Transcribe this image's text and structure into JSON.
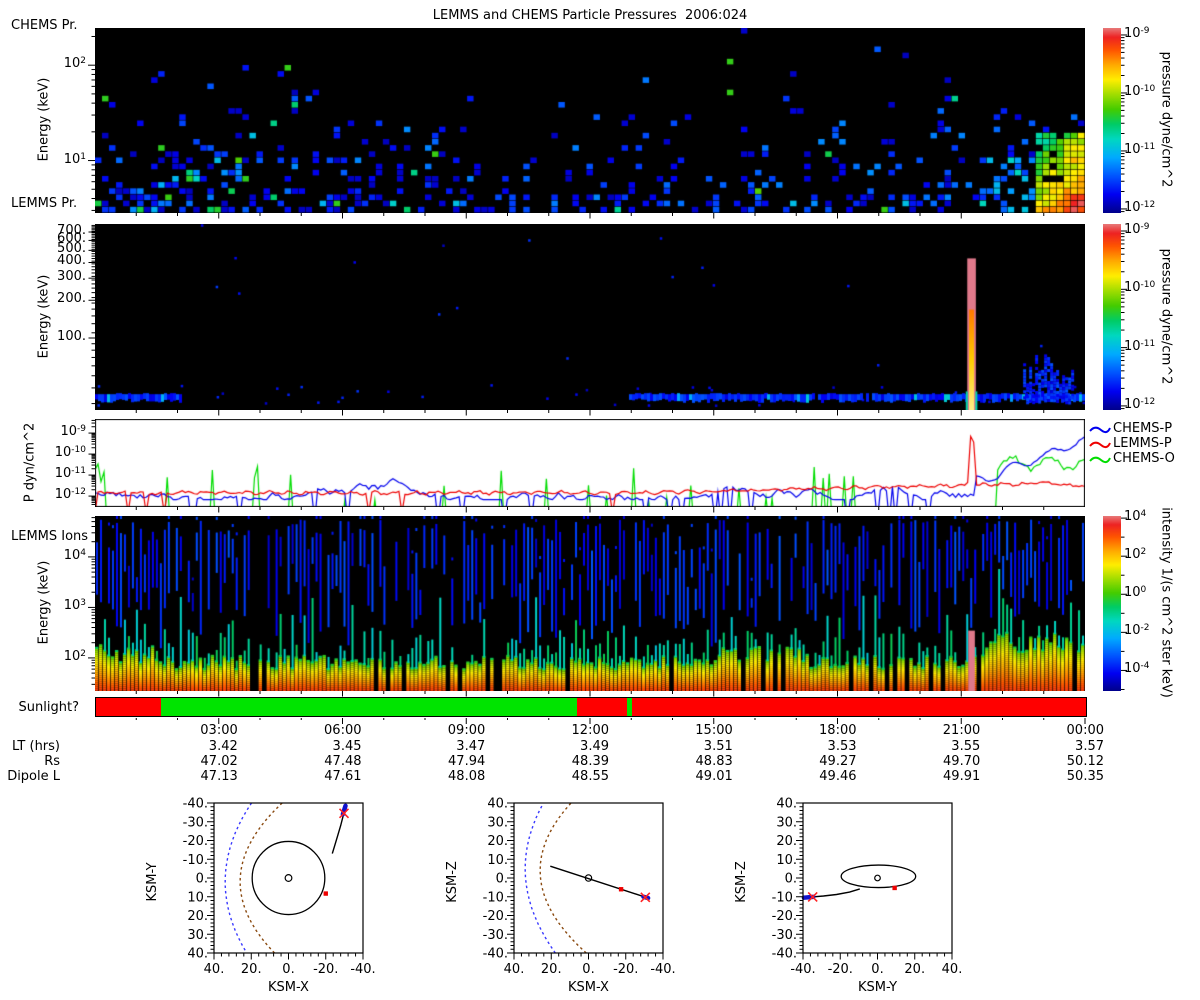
{
  "title": "LEMMS and CHEMS Particle Pressures  2006:024",
  "panel_labels": {
    "chems_pr": "CHEMS Pr.",
    "lemms_pr": "LEMMS Pr.",
    "lemms_ions": "LEMMS Ions",
    "sunlight": "Sunlight?"
  },
  "axis_labels": {
    "energy": "Energy (keV)",
    "pressure_panel": "P dyn/cm^2",
    "pressure_cb": "pressure dyne/cm^2",
    "intensity_cb": "intensity 1/(s cm^2 ster keV)"
  },
  "legend": [
    {
      "label": "CHEMS-P",
      "color": "#0000ee"
    },
    {
      "label": "LEMMS-P",
      "color": "#ee0000"
    },
    {
      "label": "CHEMS-O",
      "color": "#00dd00"
    }
  ],
  "colors": {
    "sunlight_red": "#ff0000",
    "sunlight_green": "#00e400",
    "spike_salmon": "#e0798b",
    "panel_bg": "#000000",
    "colormap": [
      [
        0,
        "#00008a"
      ],
      [
        0.1,
        "#0000f2"
      ],
      [
        0.2,
        "#0055ff"
      ],
      [
        0.3,
        "#00aaff"
      ],
      [
        0.4,
        "#00d8c0"
      ],
      [
        0.48,
        "#00cc66"
      ],
      [
        0.56,
        "#44cc00"
      ],
      [
        0.64,
        "#a0dd00"
      ],
      [
        0.72,
        "#ffee00"
      ],
      [
        0.8,
        "#ffaa00"
      ],
      [
        0.88,
        "#ff5500"
      ],
      [
        0.95,
        "#ee2222"
      ],
      [
        1,
        "#e87a7a"
      ]
    ]
  },
  "time_axis": {
    "tick_hours": [
      3,
      6,
      9,
      12,
      15,
      18,
      21,
      24
    ],
    "tick_labels": [
      "03:00",
      "06:00",
      "09:00",
      "12:00",
      "15:00",
      "18:00",
      "21:00",
      "00:00"
    ],
    "rows": [
      {
        "label": "LT (hrs)",
        "values": [
          "3.42",
          "3.45",
          "3.47",
          "3.49",
          "3.51",
          "3.53",
          "3.55",
          "3.57"
        ]
      },
      {
        "label": "Rs",
        "values": [
          "47.02",
          "47.48",
          "47.94",
          "48.39",
          "48.83",
          "49.27",
          "49.70",
          "50.12"
        ]
      },
      {
        "label": "Dipole L",
        "values": [
          "47.13",
          "47.61",
          "48.08",
          "48.55",
          "49.01",
          "49.46",
          "49.91",
          "50.35"
        ]
      }
    ]
  },
  "sunlight_segments": [
    {
      "from_h": 0,
      "to_h": 1.58,
      "color": "red"
    },
    {
      "from_h": 1.58,
      "to_h": 11.66,
      "color": "green"
    },
    {
      "from_h": 11.66,
      "to_h": 12.87,
      "color": "red"
    },
    {
      "from_h": 12.87,
      "to_h": 13.0,
      "color": "green"
    },
    {
      "from_h": 13.0,
      "to_h": 24,
      "color": "red"
    }
  ],
  "chart_data": [
    {
      "id": "chems_pressure",
      "type": "heatmap",
      "panel_label": "CHEMS Pr.",
      "ylabel": "Energy (keV)",
      "yticks": [
        "10^1",
        "10^2"
      ],
      "ylim_log_kev": [
        2.39,
        0.45
      ],
      "xlim_hours": [
        0,
        24
      ],
      "grid": false,
      "colorbar": {
        "label": "pressure dyne/cm^2",
        "ticks": [
          "10^-9",
          "10^-10",
          "10^-11",
          "10^-12"
        ],
        "range_log": [
          -8.88,
          -12.07
        ]
      },
      "description": "sparse blue pixels, denser at low energy and in first third; hot yellow-orange-red blob bottom right near 23:00-24:00",
      "gen": {
        "seed": 11,
        "cols": 141,
        "rows": 30,
        "base": 0.015,
        "bottom_gain": 0.3,
        "bottom_pow": 2.8,
        "left_frac": 0.345,
        "left_mult": 1.25,
        "mid_mult": 0.7,
        "right_mult": 0.95,
        "quiet_top_frac": 0.2,
        "quiet_mult": 0.3,
        "green_prob": 0.1,
        "blue_v": [
          0.05,
          0.27
        ],
        "green_v": [
          0.3,
          0.58
        ],
        "hot": {
          "col_frac": 0.953,
          "row_frac": 0.58,
          "density": 0.92,
          "v_base": 0.32,
          "v_span": 0.55
        },
        "near": {
          "col_frac": 0.9,
          "row_frac": 0.7,
          "density": 0.45
        }
      }
    },
    {
      "id": "lemms_pressure",
      "type": "heatmap",
      "panel_label": "LEMMS Pr.",
      "ylabel": "Energy (keV)",
      "yticks": [
        "100.",
        "200.",
        "300.",
        "400.",
        "500.",
        "600.",
        "700."
      ],
      "ylim_log_kev": [
        2.909,
        1.426
      ],
      "xlim_hours": [
        0,
        24
      ],
      "grid": false,
      "colorbar": {
        "label": "pressure dyne/cm^2",
        "ticks": [
          "10^-9",
          "10^-10",
          "10^-11",
          "10^-12"
        ],
        "range_log": [
          -8.88,
          -12.07
        ]
      },
      "description": "black panel with thin blue ~30 keV band 00:00-02:00 and 12:55-24:00, blue blob 22:30-23:45, intense salmon/orange injection spike at ~21:15",
      "gen": {
        "seed": 22,
        "band_segments_hours": [
          [
            0,
            2.06
          ],
          [
            12.9,
            24
          ]
        ],
        "band_frac": [
          0.915,
          0.962
        ],
        "band_v": [
          0.08,
          0.2
        ],
        "cyan_prob": 0.08,
        "dot_count": 60,
        "blob": {
          "hours": [
            22.5,
            23.72
          ],
          "frac": [
            0.7,
            0.955
          ],
          "col_prob": 0.85,
          "v": [
            0.08,
            0.2
          ]
        },
        "spike": {
          "hours": [
            21.17,
            21.33
          ],
          "bar_top_frac": 0.185,
          "core_top_frac": 0.46,
          "bar_color": "#e0798b",
          "core_stops": [
            "#ff7700",
            "#ffcc00",
            "#ffee88"
          ]
        }
      }
    },
    {
      "id": "particle_pressures",
      "type": "line",
      "ylabel": "P dyn/cm^2",
      "yticks": [
        "10^-9",
        "10^-10",
        "10^-11",
        "10^-12"
      ],
      "ylim_log": [
        -8.33,
        -12.52
      ],
      "xlim_hours": [
        0,
        24
      ],
      "legend_position": "right",
      "series": [
        {
          "name": "CHEMS-P",
          "color": "#0000ee",
          "gen": {
            "seed": 51,
            "base": -11.72,
            "walk": 0.35,
            "clamp": [
              -0.45,
              0.55
            ],
            "dip_prob": 0.055,
            "dip_v": -13.2,
            "rise_start_h": 21.35,
            "rise_end_level": -9.3
          }
        },
        {
          "name": "LEMMS-P",
          "color": "#ee0000",
          "gen": {
            "seed": 52,
            "base": -11.84,
            "noise": 0.06,
            "rise_start_h": 13.5,
            "rise_rate": 0.048,
            "rise_cap": 0.45,
            "end_dip_h": 23.1,
            "end_dip_rate": 0.15,
            "spike_h": 21.26,
            "spike_halfwidth_h": 0.11,
            "spike_peak": -8.2
          }
        },
        {
          "name": "CHEMS-O",
          "color": "#00dd00",
          "gen": {
            "seed": 53,
            "floor": -13.4,
            "spike_prob": 0.085,
            "spike_v": [
              -12.35,
              -10.4
            ],
            "cont_start_h": 21.85,
            "cont_base": -10.45,
            "cont_wiggle": 0.3
          }
        }
      ]
    },
    {
      "id": "lemms_ions",
      "type": "heatmap",
      "panel_label": "LEMMS Ions",
      "ylabel": "Energy (keV)",
      "yticks": [
        "10^2",
        "10^3",
        "10^4"
      ],
      "ylim_log_kev": [
        4.81,
        1.345
      ],
      "xlim_hours": [
        0,
        24
      ],
      "grid": false,
      "colorbar": {
        "label": "intensity 1/(s cm^2 ster keV)",
        "ticks": [
          "10^4",
          "10^2",
          "10^0",
          "10^-2",
          "10^-4"
        ],
        "range_log": [
          4.11,
          -5.08
        ]
      },
      "description": "dense vertical striped spectrogram: orange-red band at low energy, teal-green stems mid, sparse blue stems high energy; salmon bar at ~21:15; stronger orange band after ~21:30",
      "gen": {
        "seed": 44,
        "cols": 248,
        "gap_prob": 0.1,
        "right_gap_prob": 0.03,
        "band_top": [
          0.8,
          0.88
        ],
        "band_top_right": [
          0.66,
          0.78
        ],
        "right_start_h": 21.6,
        "bumps": [
          [
            0,
            1.6
          ],
          [
            15.2,
            17.3
          ]
        ],
        "band_top_bump": [
          0.74,
          0.84
        ],
        "band_v": [
          0.6,
          0.92
        ],
        "green_prob": 0.75,
        "green_len": [
          0.05,
          0.43
        ],
        "green_v": [
          0.36,
          0.5
        ],
        "blue_prob": 0.85,
        "blue_top": [
          0.02,
          0.52
        ],
        "blue_v": [
          0.06,
          0.2
        ],
        "salmon_bar": {
          "hours": [
            21.17,
            21.33
          ],
          "top_frac": 0.655,
          "color": "#e0798b"
        }
      }
    },
    {
      "id": "trajectory_views",
      "type": "scatter",
      "plots": [
        {
          "xlabel": "KSM-X",
          "ylabel": "KSM-Y",
          "xticks": [
            "40.",
            "20.",
            "0.",
            "-20.",
            "-40."
          ],
          "yticks": [
            "-40.",
            "-30.",
            "-20.",
            "-10.",
            "0.",
            "10.",
            "20.",
            "30.",
            "40."
          ],
          "xlim": [
            40,
            -40
          ],
          "ylim": [
            -40,
            40
          ],
          "bow_shock": {
            "nose": 34,
            "curv": 0.008,
            "y0": 2,
            "color": "#3a3aff"
          },
          "magnetopause": {
            "nose": 26,
            "curv": 0.0128,
            "y0": 2,
            "color": "#8a4a10"
          },
          "orbit_circle_r": 19.5,
          "planet_r": 1.8,
          "trajectory": [
            [
              -23.5,
              -13
            ],
            [
              -25,
              -18
            ],
            [
              -26.5,
              -23
            ],
            [
              -28,
              -28
            ],
            [
              -29.3,
              -33
            ],
            [
              -30.3,
              -37.5
            ]
          ],
          "today": [
            [
              -29.2,
              -34
            ],
            [
              -30.6,
              -38.5
            ]
          ],
          "red_x": [
            -29.8,
            -34.5
          ],
          "red_dot": [
            -20,
            8.3
          ]
        },
        {
          "xlabel": "KSM-X",
          "ylabel": "KSM-Z",
          "xticks": [
            "40.",
            "20.",
            "0.",
            "-20.",
            "-40."
          ],
          "yticks": [
            "40.",
            "30.",
            "20.",
            "10.",
            "0.",
            "-10.",
            "-20.",
            "-30.",
            "-40."
          ],
          "xlim": [
            40,
            -40
          ],
          "ylim": [
            40,
            -40
          ],
          "bow_shock": {
            "nose": 34,
            "curv": 0.008,
            "y0": 5,
            "color": "#3a3aff"
          },
          "magnetopause": {
            "nose": 26,
            "curv": 0.0128,
            "y0": 4,
            "color": "#8a4a10"
          },
          "planet_r": 1.7,
          "trajectory": [
            [
              20.5,
              6.3
            ],
            [
              -31.8,
              -10.6
            ]
          ],
          "today": [
            [
              -29.5,
              -10
            ],
            [
              -32,
              -10.7
            ]
          ],
          "red_x": [
            -30.5,
            -10.3
          ],
          "red_dot": [
            -17.5,
            -6
          ]
        },
        {
          "xlabel": "KSM-Y",
          "ylabel": "KSM-Z",
          "xticks": [
            "-40.",
            "-20.",
            "0.",
            "20.",
            "40."
          ],
          "yticks": [
            "40.",
            "30.",
            "20.",
            "10.",
            "0.",
            "-10.",
            "-20.",
            "-30.",
            "-40."
          ],
          "xlim": [
            -40,
            40
          ],
          "ylim": [
            40,
            -40
          ],
          "orbit_ellipse": {
            "cx": 0.5,
            "cy": 0.9,
            "rx": 20,
            "ry": 6
          },
          "planet_r": 1.5,
          "trajectory": [
            [
              -9.5,
              -5.8
            ],
            [
              -15,
              -7.5
            ],
            [
              -22,
              -8.8
            ],
            [
              -29,
              -9.6
            ],
            [
              -35,
              -10.1
            ],
            [
              -39,
              -10.4
            ]
          ],
          "today": [
            [
              -34.5,
              -10.05
            ],
            [
              -39.5,
              -10.5
            ]
          ],
          "red_x": [
            -34.8,
            -10.1
          ],
          "red_dot": [
            9.2,
            -5.3
          ]
        }
      ]
    }
  ]
}
